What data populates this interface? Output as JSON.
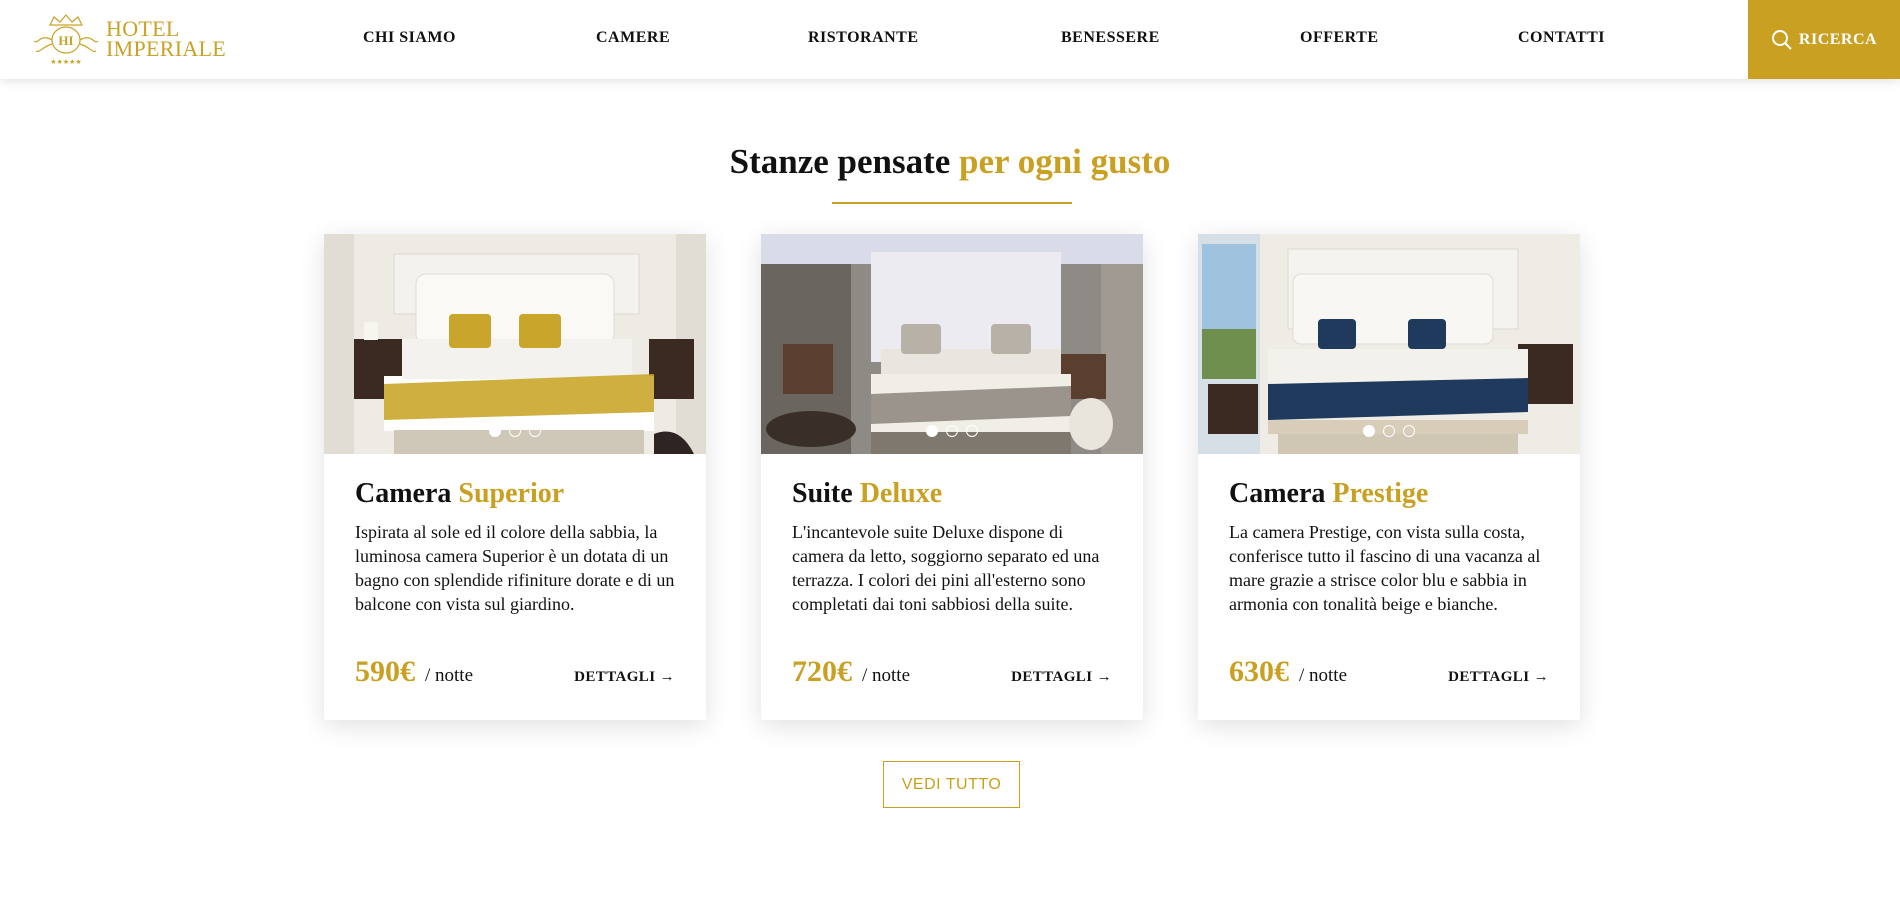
{
  "header": {
    "logo_line1": "HOTEL",
    "logo_line2": "IMPERIALE",
    "logo_monogram": "HI",
    "nav": [
      "CHI SIAMO",
      "CAMERE",
      "RISTORANTE",
      "BENESSERE",
      "OFFERTE",
      "CONTATTI"
    ],
    "search_label": "RICERCA"
  },
  "section": {
    "title_main": "Stanze pensate",
    "title_accent": "per ogni gusto"
  },
  "rooms": [
    {
      "title_main": "Camera",
      "title_accent": "Superior",
      "description": "Ispirata al sole ed il colore della sabbia, la luminosa camera Superior è un dotata di un bagno con splendide rifiniture dorate e di un balcone con vista sul giardino.",
      "price": "590€",
      "per_night": "/ notte",
      "details": "DETTAGLI →",
      "slides": 3,
      "active_slide": 1,
      "accent_color": "#c9a62b"
    },
    {
      "title_main": "Suite",
      "title_accent": "Deluxe",
      "description": "L'incantevole suite Deluxe dispone di camera da letto, soggiorno separato ed una terrazza. I colori dei pini all'esterno sono completati dai toni sabbiosi della suite.",
      "price": "720€",
      "per_night": "/ notte",
      "details": "DETTAGLI →",
      "slides": 3,
      "active_slide": 1,
      "accent_color": "#9a948c"
    },
    {
      "title_main": "Camera",
      "title_accent": "Prestige",
      "description": "La camera Prestige, con vista sulla costa, conferisce tutto il fascino di una vacanza al mare grazie a strisce color blu e sabbia in armonia con tonalità beige e bianche.",
      "price": "630€",
      "per_night": "/ notte",
      "details": "DETTAGLI →",
      "slides": 3,
      "active_slide": 1,
      "accent_color": "#1f3a5c"
    }
  ],
  "view_all_label": "VEDI TUTTO",
  "colors": {
    "gold": "#c9a021",
    "text": "#111111"
  }
}
